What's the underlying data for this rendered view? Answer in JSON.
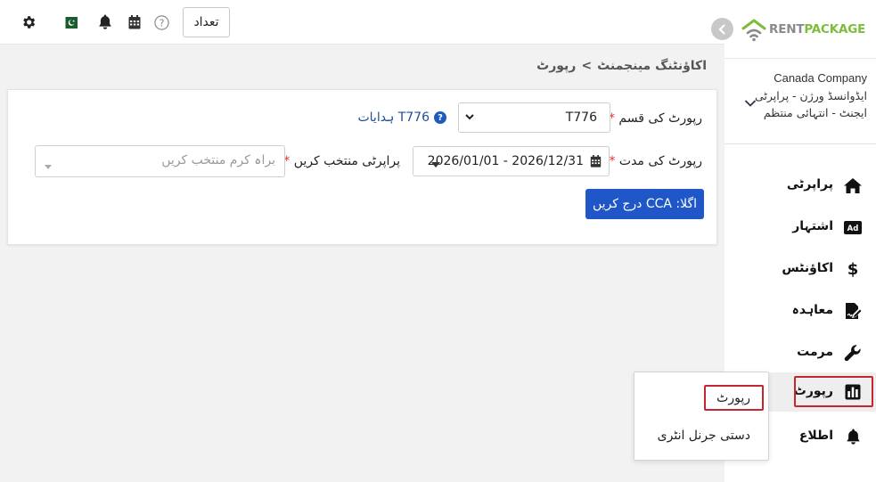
{
  "topbar": {
    "count_button": "تعداد",
    "icons": [
      "gear-icon",
      "pakistan-flag-icon",
      "bell-icon",
      "calendar-icon",
      "help-icon"
    ]
  },
  "brand": {
    "logo_part1": "RENT",
    "logo_part2": "PACKAGE",
    "logo_color_1": "#8a8a8a",
    "logo_color_2": "#7ebd3c"
  },
  "company": {
    "name": "Canada Company",
    "roles": "ایڈوانسڈ ورژن - پراپرٹی ایجنٹ - انتہائی منتظم"
  },
  "sidebar": {
    "items": [
      {
        "label": "پراپرٹی",
        "icon": "home-icon"
      },
      {
        "label": "اشتہار",
        "icon": "ad-icon"
      },
      {
        "label": "اکاؤنٹس",
        "icon": "dollar-icon"
      },
      {
        "label": "معاہدہ",
        "icon": "contract-icon"
      },
      {
        "label": "مرمت",
        "icon": "wrench-icon"
      },
      {
        "label": "رپورٹ",
        "icon": "bar-chart-icon"
      },
      {
        "label": "اطلاع",
        "icon": "bell-icon"
      }
    ],
    "active_index": 5
  },
  "submenu": {
    "items": [
      "رپورٹ",
      "دستی جرنل انٹری"
    ]
  },
  "breadcrumb": {
    "parent": "اکاؤنٹنگ مینجمنٹ",
    "separator": ">",
    "current": "رپورٹ"
  },
  "form": {
    "report_type_label": "رپورٹ کی قسم",
    "report_type_value": "T776",
    "help_text": "T776 ہدایات",
    "period_label": "رپورٹ کی مدت",
    "period_value": "2026/01/01 - 2026/12/31",
    "property_label": "پراپرٹی منتخب کریں",
    "property_placeholder": "براہ کرم منتخب کریں",
    "required_mark": "*",
    "next_button": "اگلا: CCA درج کریں"
  },
  "colors": {
    "accent": "#1f56c8",
    "highlight": "#c6262e",
    "required": "#dd3333"
  }
}
